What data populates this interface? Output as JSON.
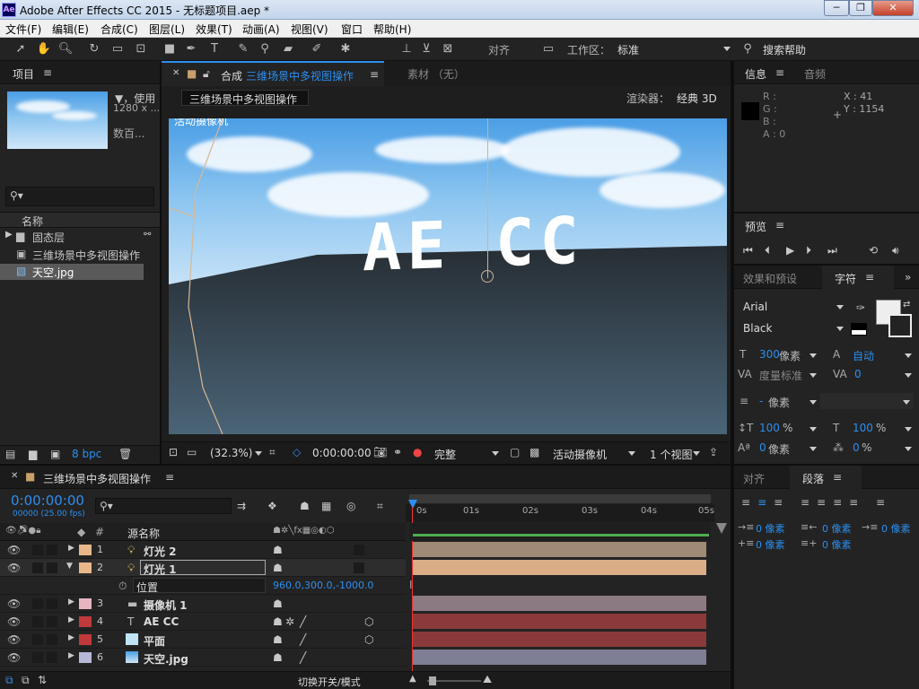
{
  "window": {
    "app_icon": "Ae",
    "title": "Adobe After Effects CC 2015 - 无标题项目.aep *",
    "minimize": "─",
    "restore": "❐",
    "close": "✕"
  },
  "menu": [
    "文件(F)",
    "编辑(E)",
    "合成(C)",
    "图层(L)",
    "效果(T)",
    "动画(A)",
    "视图(V)",
    "窗口",
    "帮助(H)"
  ],
  "toolbar": {
    "align_label": "对齐",
    "workspace_label": "工作区：",
    "workspace_value": "标准",
    "search_label": "搜索帮助"
  },
  "project": {
    "tab": "项目",
    "menu_icon": "≡",
    "thumb_info1": "▼，使用",
    "thumb_info2": "1280 x ...",
    "thumb_info3": "数百...",
    "search_placeholder": "",
    "col_name": "名称",
    "items": [
      {
        "name": "固态层",
        "type": "folder"
      },
      {
        "name": "三维场景中多视图操作",
        "type": "comp"
      },
      {
        "name": "天空.jpg",
        "type": "image",
        "selected": true
      }
    ],
    "bpc": "8 bpc"
  },
  "composition": {
    "tab_prefix": "合成",
    "tab_name": "三维场景中多视图操作",
    "footage_tab": "素材  （无）",
    "comp_label": "三维场景中多视图操作",
    "renderer_label": "渲染器：",
    "renderer_value": "经典 3D",
    "active_camera_label": "活动摄像机",
    "text_3d": "AE  CC",
    "zoom": "(32.3%)",
    "timecode": "0:00:00:00",
    "quality": "完整",
    "view_camera": "活动摄像机",
    "view_count": "1 个视图"
  },
  "info": {
    "tab_info": "信息",
    "tab_audio": "音频",
    "r": "R :",
    "g": "G :",
    "b": "B :",
    "a": "A : 0",
    "x": "X : 41",
    "y": "Y : 1154"
  },
  "preview": {
    "tab": "预览"
  },
  "character": {
    "tab_effects": "效果和预设",
    "tab_char": "字符",
    "font": "Arial",
    "style": "Black",
    "size": "300",
    "size_unit": "像素",
    "leading": "自动",
    "kerning": "度量标准",
    "tracking": "0",
    "stroke": "-",
    "stroke_unit": "像素",
    "vscale": "100",
    "hscale": "100",
    "percent": "%",
    "baseline": "0",
    "baseline_unit": "像素",
    "tsume": "0",
    "tsume_unit": "%"
  },
  "paragraph": {
    "tab_align": "对齐",
    "tab_para": "段落",
    "indent_left": "0 像素",
    "indent_right": "0 像素",
    "indent_first": "0 像素",
    "space_before": "0 像素",
    "space_after": "0 像素"
  },
  "timeline": {
    "comp_name": "三维场景中多视图操作",
    "timecode": "0:00:00:00",
    "frame_info": "00000 (25.00 fps)",
    "col_source": "源名称",
    "ticks": [
      "0s",
      "01s",
      "02s",
      "03s",
      "04s",
      "05s"
    ],
    "layers": [
      {
        "num": "1",
        "name": "灯光 2",
        "color": "#e8b88a",
        "bar": "#9f8a75"
      },
      {
        "num": "2",
        "name": "灯光 1",
        "color": "#e8b88a",
        "bar": "#d9ae86"
      },
      {
        "num": "3",
        "name": "摄像机 1",
        "color": "#e6b5c0",
        "bar": "#8c7a82"
      },
      {
        "num": "4",
        "name": "AE CC",
        "color": "#c0393b",
        "bar": "#8a3a3a"
      },
      {
        "num": "5",
        "name": "平面",
        "color": "#c0393b",
        "bar": "#8a3a3a"
      },
      {
        "num": "6",
        "name": "天空.jpg",
        "color": "#b7b8d8",
        "bar": "#7e7e95"
      }
    ],
    "property_name": "位置",
    "property_value": "960.0,300.0,-1000.0",
    "footer_toggle": "切换开关/模式"
  },
  "colors": {
    "accent": "#2c8ff0",
    "panel": "#232323",
    "header": "#1b1b1b"
  }
}
